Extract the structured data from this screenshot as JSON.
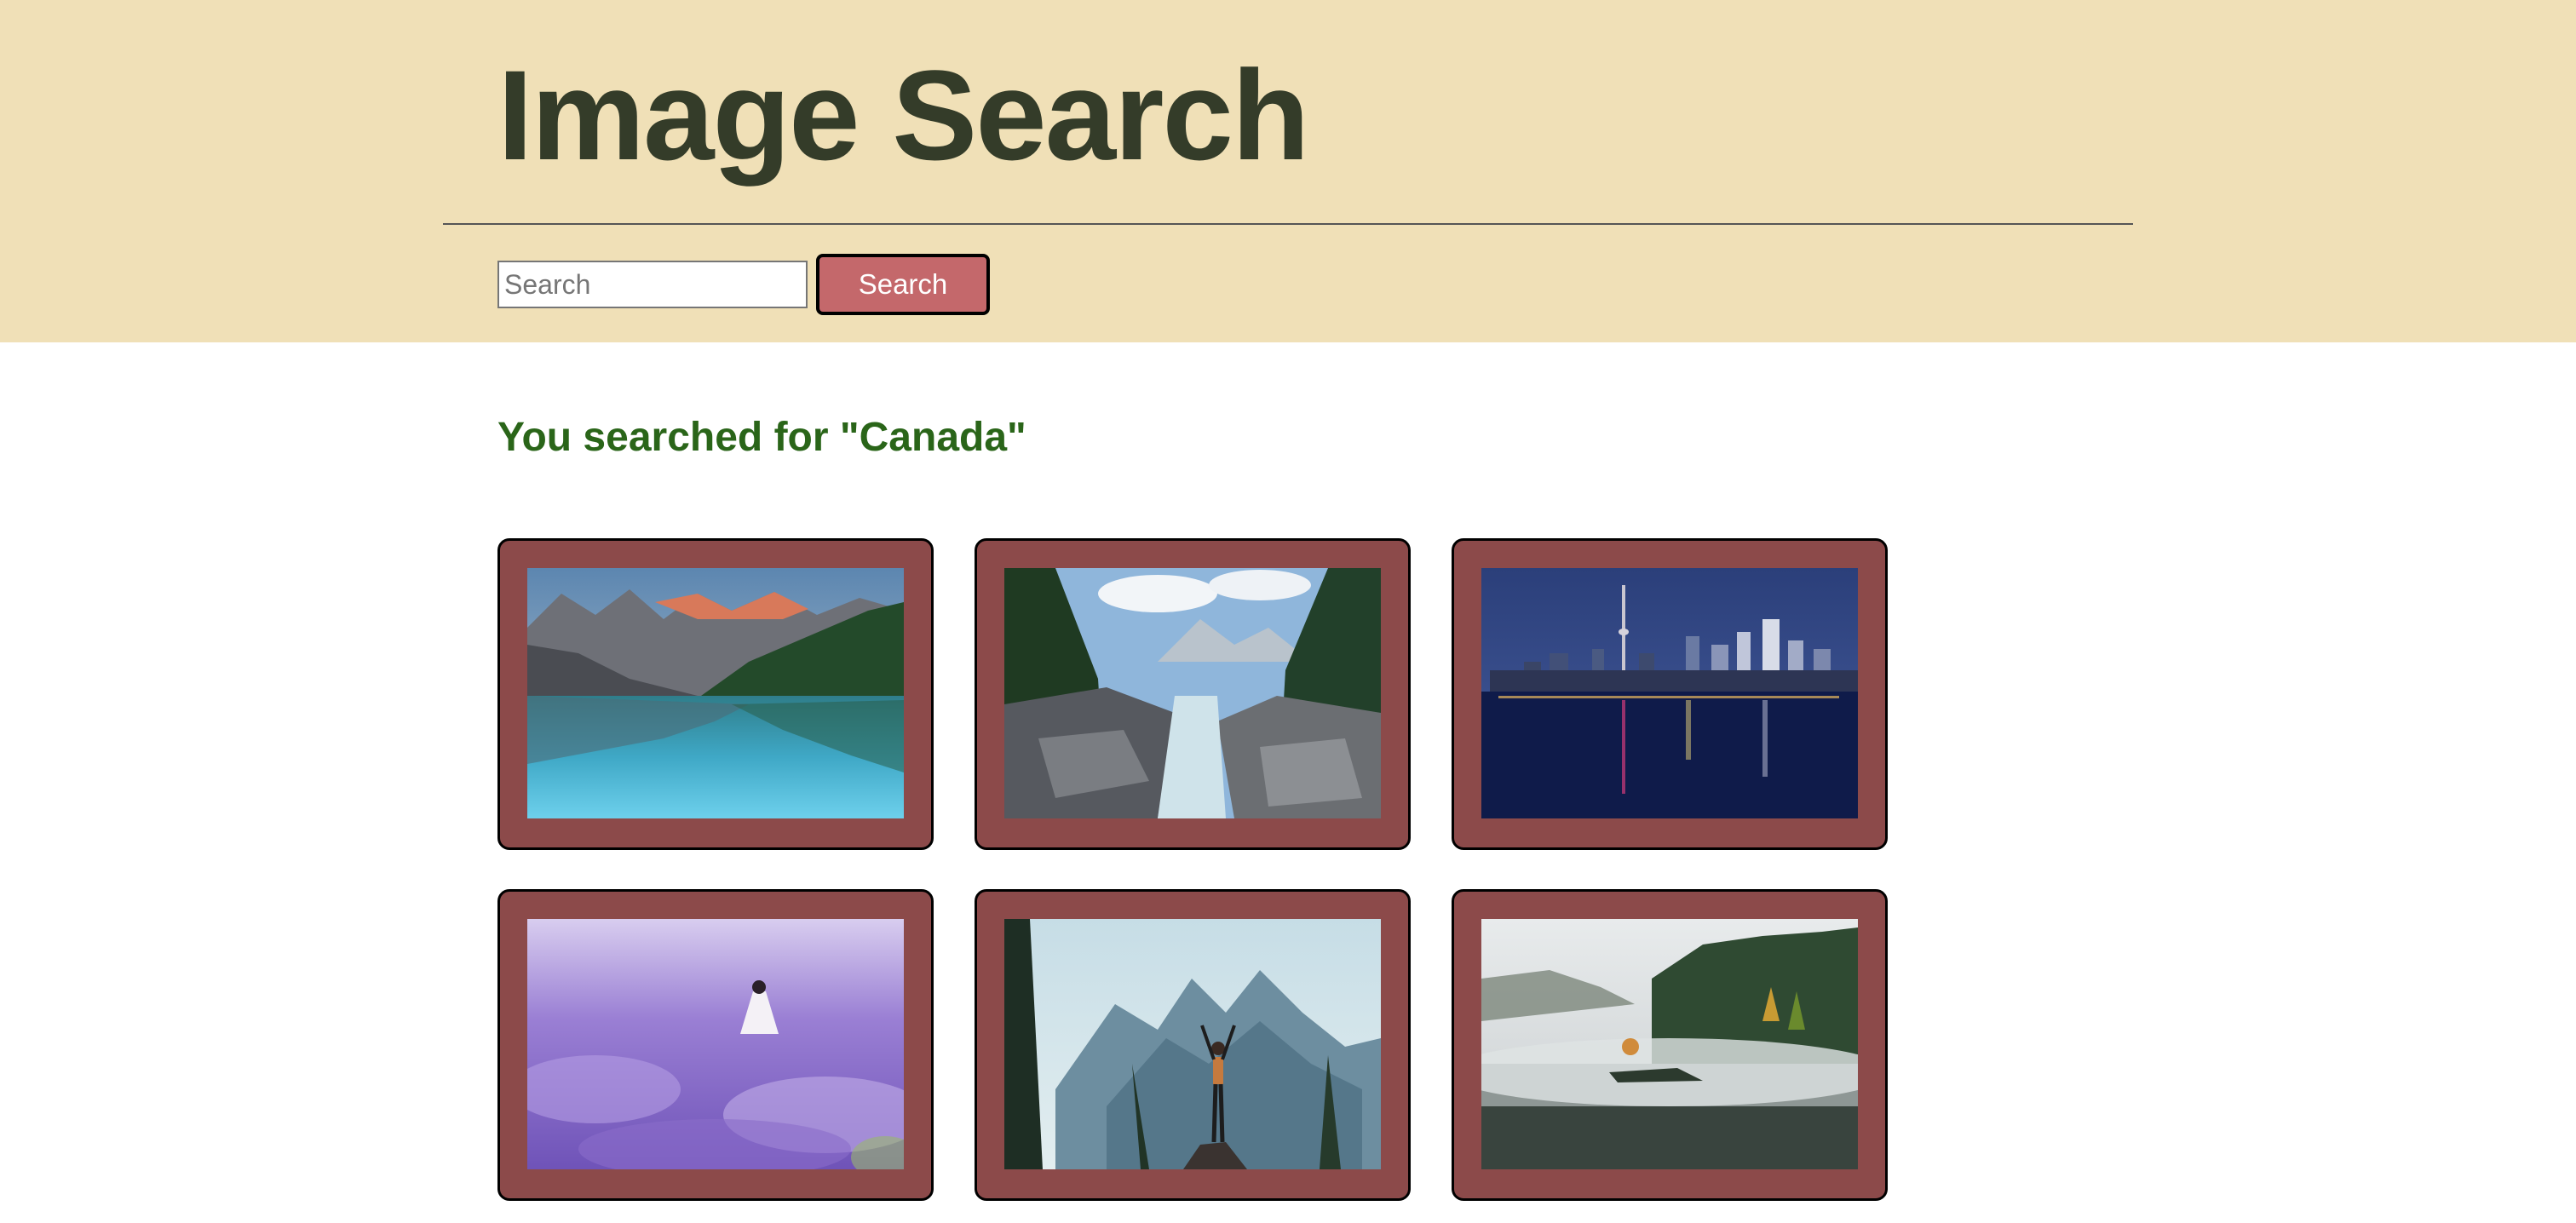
{
  "header": {
    "title": "Image Search"
  },
  "search": {
    "placeholder": "Search",
    "value": "",
    "button_label": "Search"
  },
  "results": {
    "heading": "You searched for \"Canada\"",
    "images": [
      {
        "subject": "moraine-lake-mountains"
      },
      {
        "subject": "river-canyon-forest"
      },
      {
        "subject": "toronto-skyline-night"
      },
      {
        "subject": "lavender-field-person"
      },
      {
        "subject": "hiker-mountain-peaks"
      },
      {
        "subject": "misty-lake-forest"
      }
    ]
  },
  "colors": {
    "header_bg": "#f0e0b7",
    "title": "#343c29",
    "button_bg": "#c4686b",
    "heading": "#2a6519",
    "card_bg": "#8c4a4a"
  }
}
